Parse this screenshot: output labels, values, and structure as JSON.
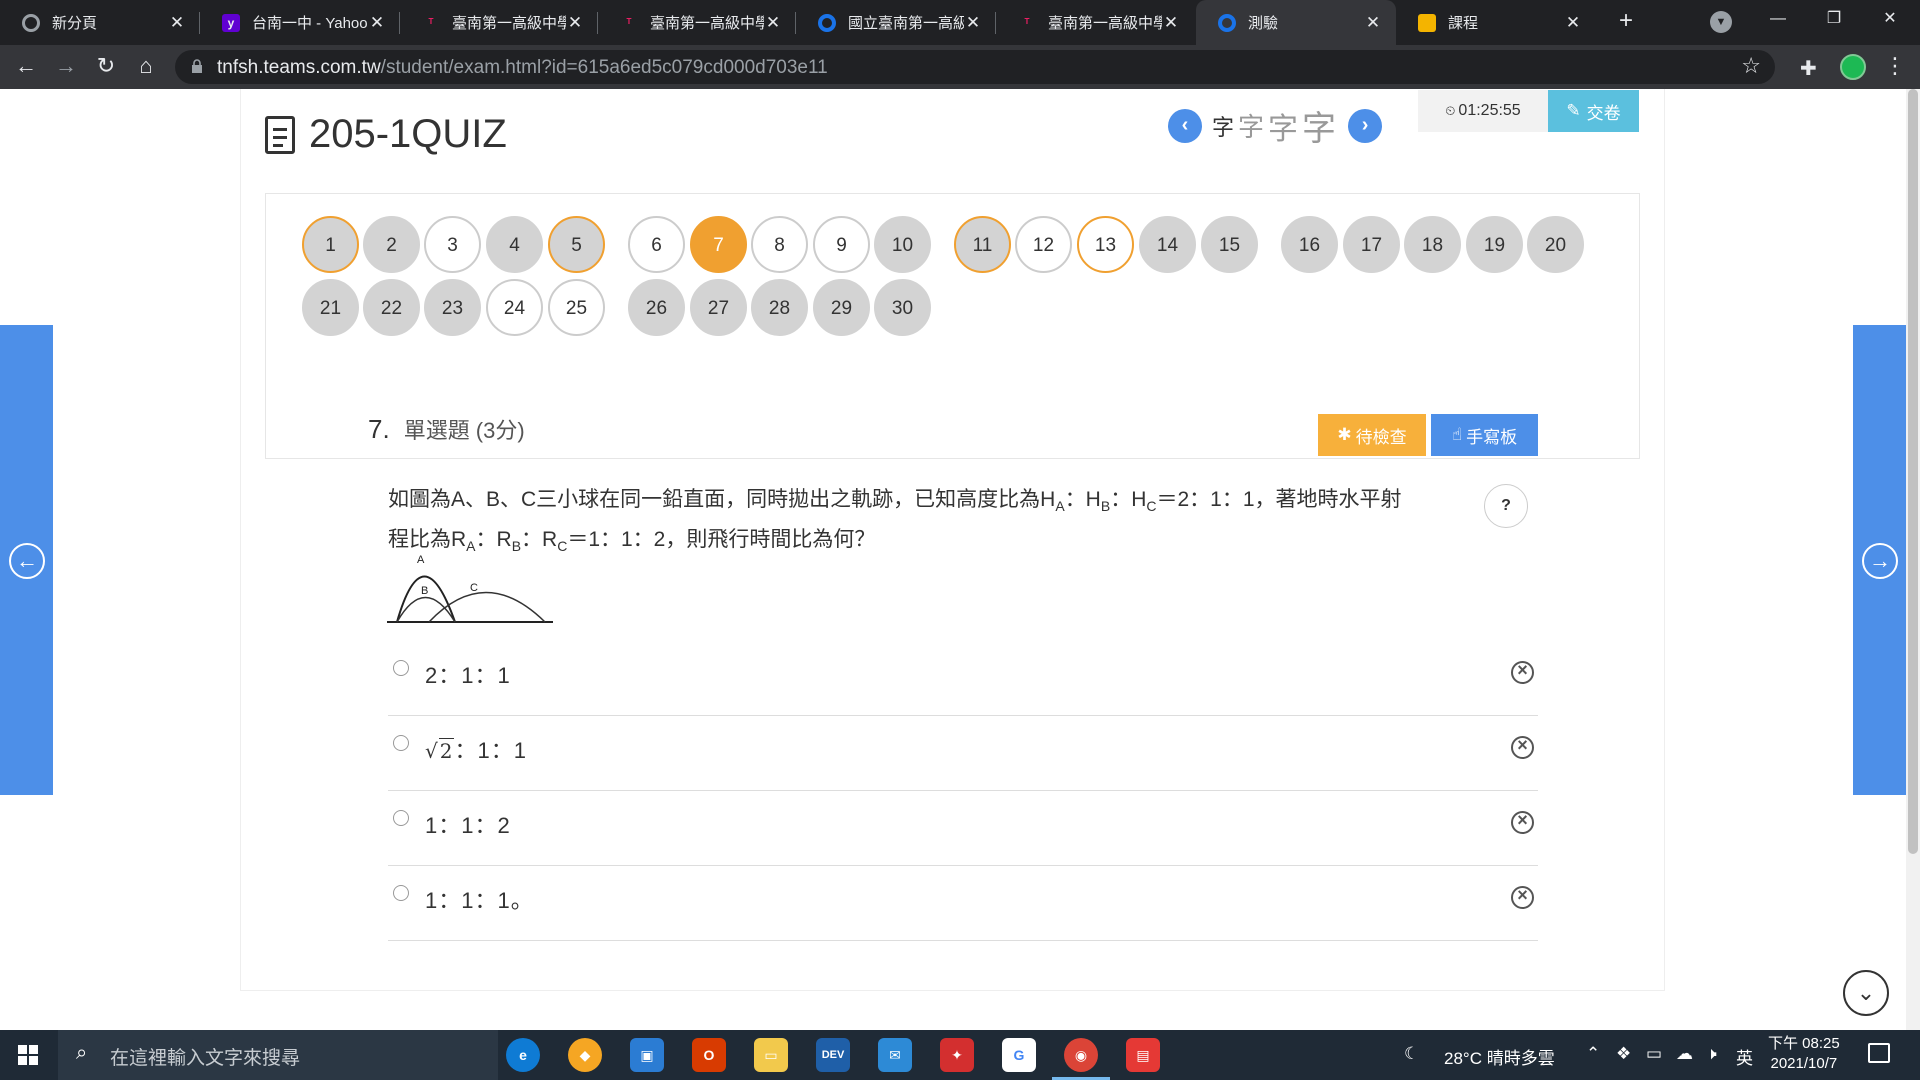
{
  "browser": {
    "tabs": [
      {
        "title": "新分頁",
        "icon": "chrome-icon",
        "color": "#5f6368",
        "active": false
      },
      {
        "title": "台南一中 - Yahoo",
        "icon": "yahoo-icon",
        "color": "#6001d2",
        "active": false
      },
      {
        "title": "臺南第一高級中學",
        "icon": "school-icon",
        "color": "#c2185b",
        "active": false
      },
      {
        "title": "臺南第一高級中學",
        "icon": "school-icon",
        "color": "#c2185b",
        "active": false
      },
      {
        "title": "國立臺南第一高級",
        "icon": "teams-icon",
        "color": "#1a73e8",
        "active": false
      },
      {
        "title": "臺南第一高級中學",
        "icon": "school-icon",
        "color": "#c2185b",
        "active": false
      },
      {
        "title": "測驗",
        "icon": "teams-icon",
        "color": "#1a73e8",
        "active": true
      },
      {
        "title": "課程",
        "icon": "course-icon",
        "color": "#f4b400",
        "active": false
      }
    ],
    "url_host": "tnfsh.teams.com.tw",
    "url_path": "/student/exam.html?id=615a6ed5c079cd000d703e11"
  },
  "exam": {
    "title": "205-1QUIZ",
    "font_sizes": [
      "字",
      "字",
      "字",
      "字"
    ],
    "timer": "01:25:55",
    "submit_label": "交卷"
  },
  "question_nav": {
    "row1": [
      {
        "n": "1",
        "state": "answered-flagged"
      },
      {
        "n": "2",
        "state": "answered"
      },
      {
        "n": "3",
        "state": "unanswered"
      },
      {
        "n": "4",
        "state": "answered"
      },
      {
        "n": "5",
        "state": "answered-flagged"
      },
      {
        "n": "6",
        "state": "unanswered"
      },
      {
        "n": "7",
        "state": "current"
      },
      {
        "n": "8",
        "state": "unanswered"
      },
      {
        "n": "9",
        "state": "unanswered"
      },
      {
        "n": "10",
        "state": "answered"
      },
      {
        "n": "11",
        "state": "answered-flagged"
      },
      {
        "n": "12",
        "state": "unanswered"
      },
      {
        "n": "13",
        "state": "flagged"
      },
      {
        "n": "14",
        "state": "answered"
      },
      {
        "n": "15",
        "state": "answered"
      },
      {
        "n": "16",
        "state": "answered"
      },
      {
        "n": "17",
        "state": "answered"
      },
      {
        "n": "18",
        "state": "answered"
      },
      {
        "n": "19",
        "state": "answered"
      },
      {
        "n": "20",
        "state": "answered"
      }
    ],
    "row2": [
      {
        "n": "21",
        "state": "answered"
      },
      {
        "n": "22",
        "state": "answered"
      },
      {
        "n": "23",
        "state": "answered"
      },
      {
        "n": "24",
        "state": "unanswered"
      },
      {
        "n": "25",
        "state": "unanswered"
      },
      {
        "n": "26",
        "state": "answered"
      },
      {
        "n": "27",
        "state": "answered"
      },
      {
        "n": "28",
        "state": "answered"
      },
      {
        "n": "29",
        "state": "answered"
      },
      {
        "n": "30",
        "state": "answered"
      }
    ]
  },
  "question": {
    "number": "7.",
    "type": "單選題 (3分)",
    "review_label": "待檢查",
    "handwrite_label": "手寫板",
    "help_label": "?",
    "text_line1_a": "如圖為A、B、C三小球在同一鉛直面，同時拋出之軌跡，已知高度比為H",
    "text_line1_b": "：H",
    "text_line1_c": "：H",
    "text_line1_d": "＝2：1：1，著地時水平射",
    "text_line2_a": "程比為R",
    "text_line2_b": "：R",
    "text_line2_c": "：R",
    "text_line2_d": "＝1：1：2，則飛行時間比為何？",
    "sub_a": "A",
    "sub_b": "B",
    "sub_c": "C",
    "figure_labels": {
      "a": "A",
      "b": "B",
      "c": "C"
    },
    "options": [
      {
        "text": "2：1：1"
      },
      {
        "radical": "2",
        "text": "：1：1"
      },
      {
        "text": "1：1：2"
      },
      {
        "text": "1：1：1。"
      }
    ]
  },
  "taskbar": {
    "search_placeholder": "在這裡輸入文字來搜尋",
    "weather": "28°C  晴時多雲",
    "ime": "英",
    "time": "下午 08:25",
    "date": "2021/10/7"
  }
}
